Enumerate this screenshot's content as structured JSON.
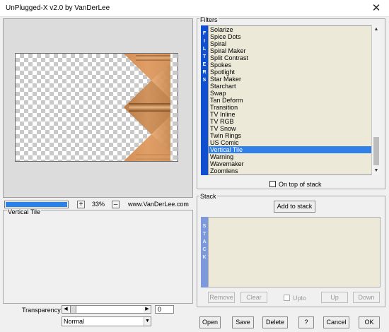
{
  "window": {
    "title": "UnPlugged-X v2.0 by VanDerLee",
    "close_glyph": "✕"
  },
  "zoom": {
    "level": "33%",
    "plus": "+",
    "minus": "–",
    "progress_fraction": 0.98
  },
  "site_link": "www.VanDerLee.com",
  "filter_panel": {
    "label": "Vertical Tile"
  },
  "transparency": {
    "label": "Transparency",
    "value": "0",
    "left_arrow": "◀",
    "right_arrow": "▶"
  },
  "blend_mode": {
    "selected": "Normal",
    "arrow": "▼"
  },
  "filters": {
    "label": "Filters",
    "side_tab": "FILTERS",
    "items": [
      "Solarize",
      "Spice Dots",
      "Spiral",
      "Spiral Maker",
      "Split Contrast",
      "Spokes",
      "Spotlight",
      "Star Maker",
      "Starchart",
      "Swap",
      "Tan Deform",
      "Transition",
      "TV Inline",
      "TV RGB",
      "TV Snow",
      "Twin Rings",
      "US Comic",
      "Vertical Tile",
      "Warning",
      "Wavemaker",
      "Zoomlens"
    ],
    "selected": "Vertical Tile",
    "scroll_up": "▲",
    "scroll_down": "▼"
  },
  "on_top": {
    "label": "On top of stack",
    "checked": false
  },
  "stack": {
    "label": "Stack",
    "side_tab": "STACK",
    "add_button": "Add to stack",
    "remove_button": "Remove",
    "clear_button": "Clear",
    "upto_label": "Upto",
    "up_button": "Up",
    "down_button": "Down"
  },
  "buttons": {
    "open": "Open",
    "save": "Save",
    "delete": "Delete",
    "help": "?",
    "cancel": "Cancel",
    "ok": "OK"
  },
  "colors": {
    "accent_blue": "#1050d0",
    "selection": "#3180e8",
    "list_bg": "#ece9d8",
    "tile_orange": "#e8a068"
  }
}
